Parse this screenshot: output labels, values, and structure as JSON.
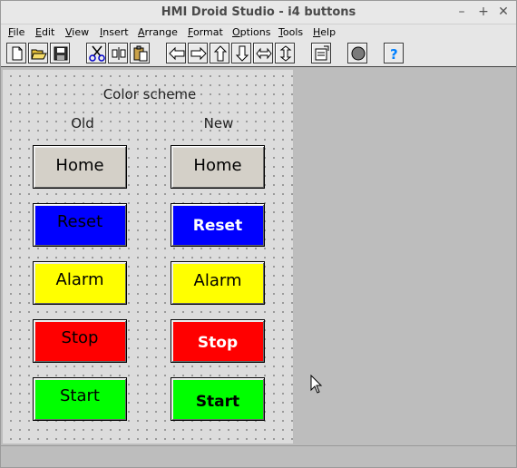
{
  "window": {
    "title": "HMI Droid Studio - i4 buttons",
    "controls": {
      "minimize": "–",
      "maximize": "+",
      "close": "✕"
    }
  },
  "menu": [
    {
      "label": "File",
      "u": "F",
      "rest": "ile"
    },
    {
      "label": "Edit",
      "u": "E",
      "rest": "dit"
    },
    {
      "label": "View",
      "u": "V",
      "rest": "iew"
    },
    {
      "label": "Insert",
      "u": "I",
      "rest": "nsert"
    },
    {
      "label": "Arrange",
      "u": "A",
      "rest": "rrange"
    },
    {
      "label": "Format",
      "u": "F",
      "rest": "ormat"
    },
    {
      "label": "Options",
      "u": "O",
      "rest": "ptions"
    },
    {
      "label": "Tools",
      "u": "T",
      "rest": "ools"
    },
    {
      "label": "Help",
      "u": "H",
      "rest": "elp"
    }
  ],
  "toolbar": [
    "new-file-icon",
    "open-folder-icon",
    "save-icon",
    "cut-icon",
    "align-icon",
    "paste-icon",
    "arrow-left-icon",
    "arrow-right-icon",
    "arrow-up-icon",
    "arrow-down-icon",
    "resize-horizontal-icon",
    "resize-vertical-icon",
    "properties-icon",
    "record-icon",
    "help-icon"
  ],
  "screen": {
    "heading": "Color scheme",
    "col_old": "Old",
    "col_new": "New",
    "old_buttons": [
      {
        "label": "Home",
        "color": "#d4d0c8"
      },
      {
        "label": "Reset",
        "color": "#0000ff"
      },
      {
        "label": "Alarm",
        "color": "#ffff00"
      },
      {
        "label": "Stop",
        "color": "#ff0000"
      },
      {
        "label": "Start",
        "color": "#00ff00"
      }
    ],
    "new_buttons": [
      {
        "label": "Home",
        "color": "#d4d0c8",
        "text_color": "#000000"
      },
      {
        "label": "Reset",
        "color": "#0000ff",
        "text_color": "#ffffff"
      },
      {
        "label": "Alarm",
        "color": "#ffff00",
        "text_color": "#000000"
      },
      {
        "label": "Stop",
        "color": "#ff0000",
        "text_color": "#ffffff"
      },
      {
        "label": "Start",
        "color": "#00ff00",
        "text_color": "#000000"
      }
    ]
  }
}
